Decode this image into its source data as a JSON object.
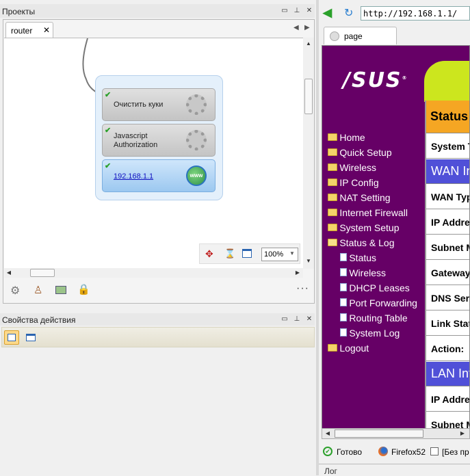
{
  "projects_panel": {
    "title": "Проекты",
    "tab_label": "router",
    "zoom": "100%",
    "nodes": [
      {
        "label": "Очистить куки"
      },
      {
        "label": "Javascript\nAuthorization"
      },
      {
        "label": "192.168.1.1"
      }
    ]
  },
  "properties_panel": {
    "title": "Свойства действия"
  },
  "browser": {
    "address": "http://192.168.1.1/",
    "tab_label": "page",
    "status_text": "Готово",
    "browser_label": "Firefox52",
    "extra_label": "[Без пр",
    "log_label": "Лог"
  },
  "router_page": {
    "logo_text": "/SUS",
    "menu": [
      {
        "label": "Home"
      },
      {
        "label": "Quick Setup"
      },
      {
        "label": "Wireless"
      },
      {
        "label": "IP Config"
      },
      {
        "label": "NAT Setting"
      },
      {
        "label": "Internet Firewall"
      },
      {
        "label": "System Setup"
      },
      {
        "label": "Status & Log"
      }
    ],
    "submenu": [
      {
        "label": "Status"
      },
      {
        "label": "Wireless"
      },
      {
        "label": "DHCP Leases"
      },
      {
        "label": "Port Forwarding"
      },
      {
        "label": "Routing Table"
      },
      {
        "label": "System Log"
      }
    ],
    "logout": "Logout",
    "status_header": "Status",
    "rows": [
      "System T",
      "WAN In",
      "WAN Type",
      "IP Addres",
      "Subnet M",
      "Gateway:",
      "DNS Serv",
      "Link Statu",
      "Action:",
      "LAN Inf",
      "IP Addres",
      "Subnet M"
    ]
  }
}
